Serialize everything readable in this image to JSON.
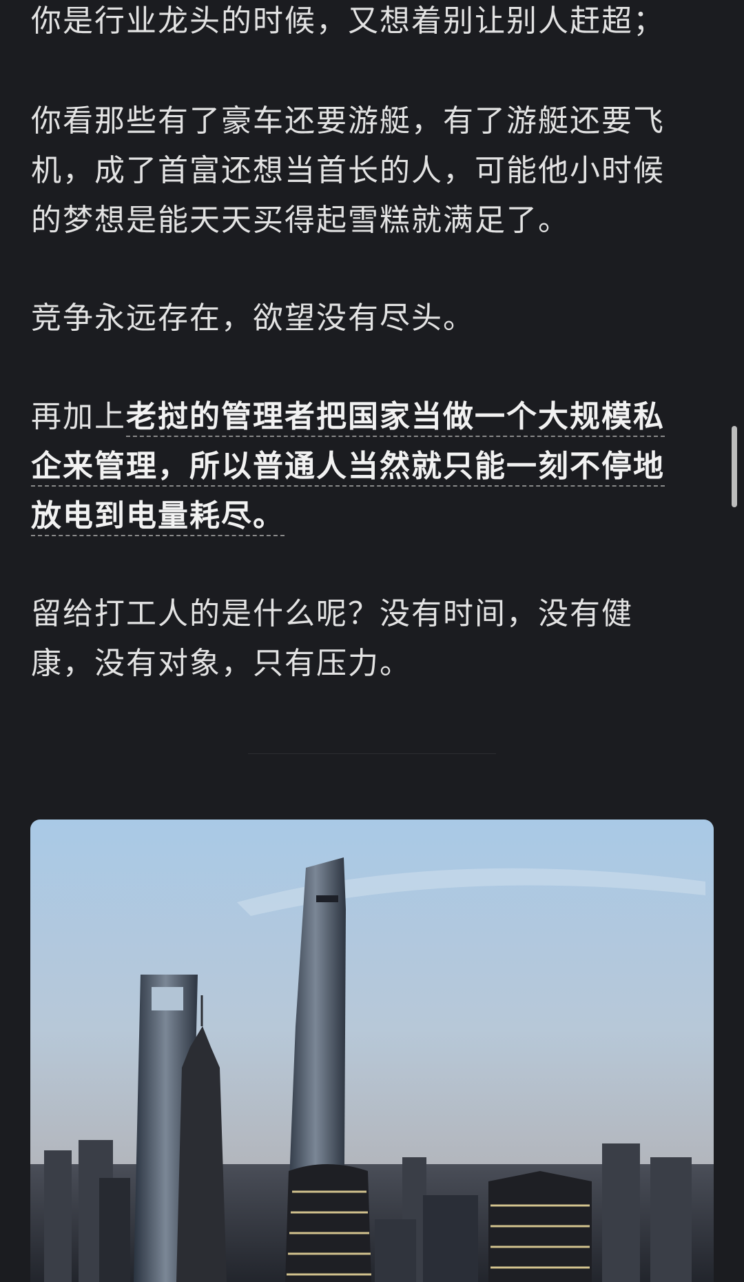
{
  "article": {
    "p1": "你是行业龙头的时候，又想着别让别人赶超；",
    "p2": "你看那些有了豪车还要游艇，有了游艇还要飞机，成了首富还想当首长的人，可能他小时候的梦想是能天天买得起雪糕就满足了。",
    "p3": "竞争永远存在，欲望没有尽头。",
    "p4_prefix": "再加上",
    "p4_highlight": "老挝的管理者把国家当做一个大规模私企来管理，所以普通人当然就只能一刻不停地放电到电量耗尽。",
    "p5": "留给打工人的是什么呢？没有时间，没有健康，没有对象，只有压力。"
  },
  "image": {
    "subject": "city-skyline-photo"
  },
  "colors": {
    "background": "#1b1c20",
    "text": "#e3e3e3",
    "highlight_underline": "#8a8a8a",
    "scrollbar": "#bdbdbd"
  }
}
